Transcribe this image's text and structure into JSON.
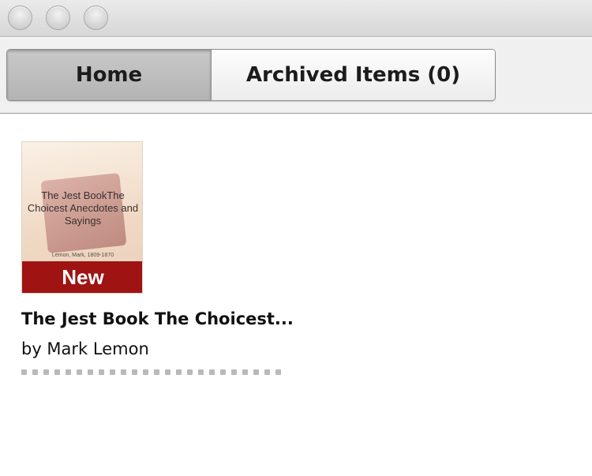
{
  "tabs": {
    "home_label": "Home",
    "archived_label": "Archived Items (0)"
  },
  "book": {
    "cover_title": "The Jest BookThe Choicest Anecdotes and Sayings",
    "cover_author": "Lemon, Mark, 1809-1870",
    "badge": "New",
    "title": "The Jest Book The Choicest...",
    "author": "by Mark Lemon",
    "progress_fraction": 0.0
  },
  "colors": {
    "badge_bg": "#a01313",
    "selected_tab": "#b9b9b9"
  }
}
